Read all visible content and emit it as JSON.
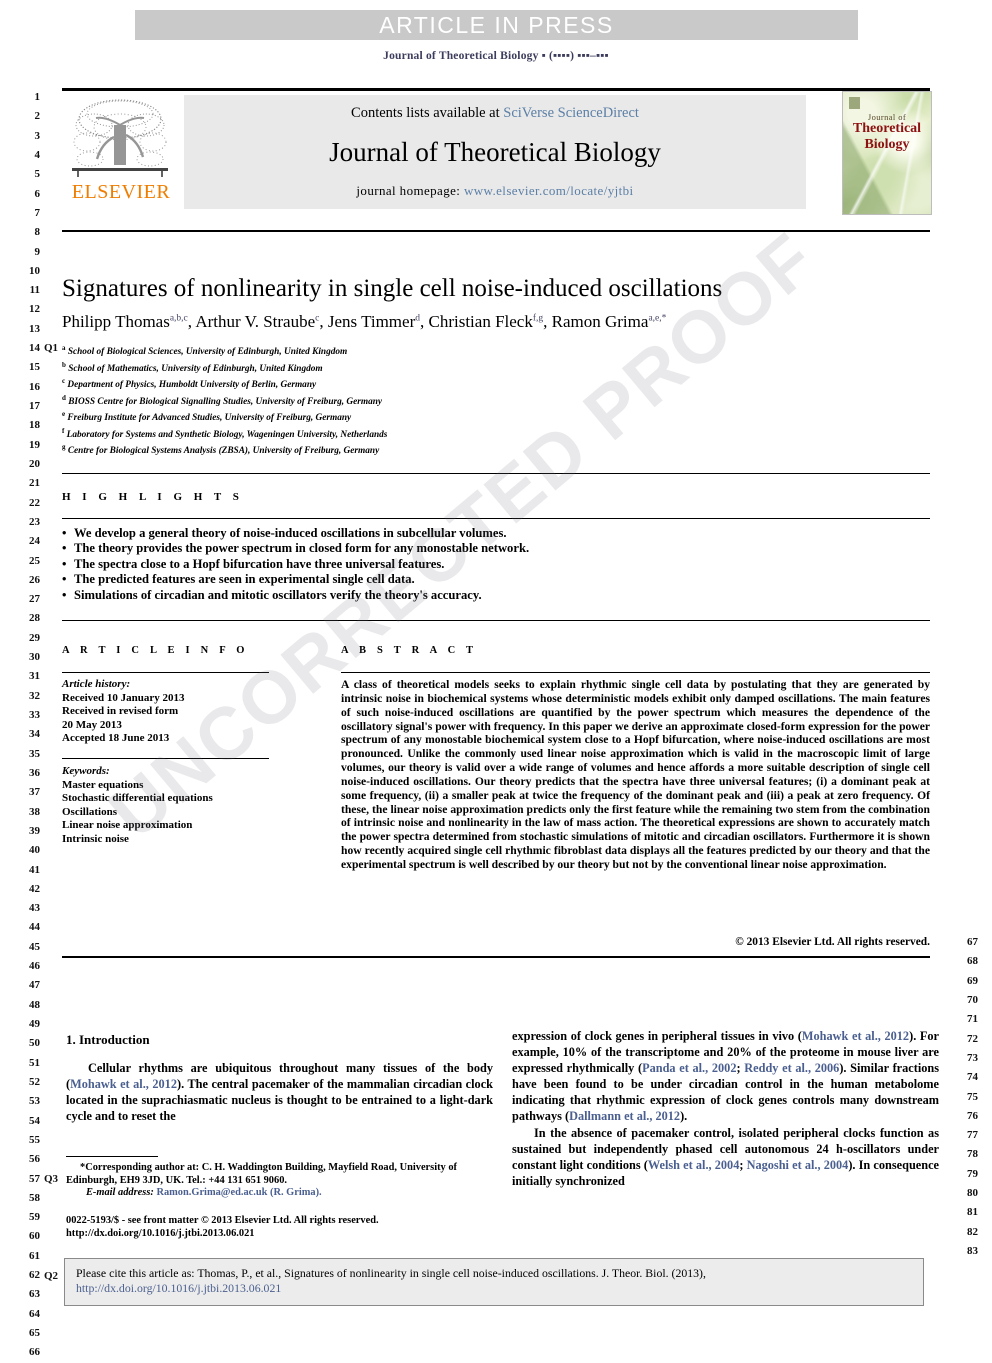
{
  "banner": {
    "text": "ARTICLE IN PRESS"
  },
  "running_head": "Journal of Theoretical Biology ▪ (▪▪▪▪) ▪▪▪–▪▪▪",
  "masthead": {
    "contents_prefix": "Contents lists available at ",
    "contents_link": "SciVerse ScienceDirect",
    "journal_title": "Journal of Theoretical Biology",
    "homepage_prefix": "journal homepage: ",
    "homepage_link": "www.elsevier.com/locate/yjtbi",
    "publisher": "ELSEVIER",
    "cover": {
      "line1": "Journal of",
      "line2": "Theoretical",
      "line3": "Biology"
    }
  },
  "article": {
    "title": "Signatures of nonlinearity in single cell noise-induced oscillations",
    "authors": [
      {
        "name": "Philipp Thomas",
        "sup": "a,b,c"
      },
      {
        "name": "Arthur V. Straube",
        "sup": "c"
      },
      {
        "name": "Jens Timmer",
        "sup": "d"
      },
      {
        "name": "Christian Fleck",
        "sup": "f,g"
      },
      {
        "name": "Ramon Grima",
        "sup": "a,e,*"
      }
    ],
    "affiliations": [
      {
        "key": "a",
        "text": "School of Biological Sciences, University of Edinburgh, United Kingdom"
      },
      {
        "key": "b",
        "text": "School of Mathematics, University of Edinburgh, United Kingdom"
      },
      {
        "key": "c",
        "text": "Department of Physics, Humboldt University of Berlin, Germany"
      },
      {
        "key": "d",
        "text": "BIOSS Centre for Biological Signalling Studies, University of Freiburg, Germany"
      },
      {
        "key": "e",
        "text": "Freiburg Institute for Advanced Studies, University of Freiburg, Germany"
      },
      {
        "key": "f",
        "text": "Laboratory for Systems and Synthetic Biology, Wageningen University, Netherlands"
      },
      {
        "key": "g",
        "text": "Centre for Biological Systems Analysis (ZBSA), University of Freiburg, Germany"
      }
    ]
  },
  "highlights": {
    "heading": "H I G H L I G H T S",
    "items": [
      "We develop a general theory of noise-induced oscillations in subcellular volumes.",
      "The theory provides the power spectrum in closed form for any monostable network.",
      "The spectra close to a Hopf bifurcation have three universal features.",
      "The predicted features are seen in experimental single cell data.",
      "Simulations of circadian and mitotic oscillators verify the theory's accuracy."
    ]
  },
  "article_info": {
    "heading": "A R T I C L E  I N F O",
    "history_label": "Article history:",
    "history": [
      "Received 10 January 2013",
      "Received in revised form",
      "20 May 2013",
      "Accepted 18 June 2013"
    ],
    "keywords_label": "Keywords:",
    "keywords": [
      "Master equations",
      "Stochastic differential equations",
      "Oscillations",
      "Linear noise approximation",
      "Intrinsic noise"
    ]
  },
  "abstract": {
    "heading": "A B S T R A C T",
    "text": "A class of theoretical models seeks to explain rhythmic single cell data by postulating that they are generated by intrinsic noise in biochemical systems whose deterministic models exhibit only damped oscillations. The main features of such noise-induced oscillations are quantified by the power spectrum which measures the dependence of the oscillatory signal's power with frequency. In this paper we derive an approximate closed-form expression for the power spectrum of any monostable biochemical system close to a Hopf bifurcation, where noise-induced oscillations are most pronounced. Unlike the commonly used linear noise approximation which is valid in the macroscopic limit of large volumes, our theory is valid over a wide range of volumes and hence affords a more suitable description of single cell noise-induced oscillations. Our theory predicts that the spectra have three universal features; (i) a dominant peak at some frequency, (ii) a smaller peak at twice the frequency of the dominant peak and (iii) a peak at zero frequency. Of these, the linear noise approximation predicts only the first feature while the remaining two stem from the combination of intrinsic noise and nonlinearity in the law of mass action. The theoretical expressions are shown to accurately match the power spectra determined from stochastic simulations of mitotic and circadian oscillators. Furthermore it is shown how recently acquired single cell rhythmic fibroblast data displays all the features predicted by our theory and that the experimental spectrum is well described by our theory but not by the conventional linear noise approximation.",
    "copyright": "© 2013 Elsevier Ltd. All rights reserved."
  },
  "body": {
    "section_number": "1.",
    "section_title": "Introduction",
    "left_column": [
      "Cellular rhythms are ubiquitous throughout many tissues of the body (Mohawk et al., 2012). The central pacemaker of the mammalian circadian clock located in the suprachiasmatic nucleus is thought to be entrained to a light-dark cycle and to reset the"
    ],
    "right_column": [
      "expression of clock genes in peripheral tissues in vivo (Mohawk et al., 2012). For example, 10% of the transcriptome and 20% of the proteome in mouse liver are expressed rhythmically (Panda et al., 2002; Reddy et al., 2006). Similar fractions have been found to be under circadian control in the human metabolome indicating that rhythmic expression of clock genes controls many downstream pathways (Dallmann et al., 2012).",
      "In the absence of pacemaker control, isolated peripheral clocks function as sustained but independently phased cell autonomous 24 h-oscillators under constant light conditions (Welsh et al., 2004; Nagoshi et al., 2004). In consequence initially synchronized"
    ]
  },
  "footnote": {
    "corresponding": "*Corresponding author at: C. H. Waddington Building, Mayfield Road, University of Edinburgh, EH9 3JD, UK. Tel.: +44 131 651 9060.",
    "email_label": "E-mail address:",
    "email": "Ramon.Grima@ed.ac.uk (R. Grima).",
    "issn_line": "0022-5193/$ - see front matter © 2013 Elsevier Ltd. All rights reserved.",
    "doi_line": "http://dx.doi.org/10.1016/j.jtbi.2013.06.021"
  },
  "citation_box": {
    "text": "Please cite this article as: Thomas, P., et al., Signatures of nonlinearity in single cell noise-induced oscillations. J. Theor. Biol. (2013), ",
    "link1": "http://dx.doi.org/10.1016/j.jtbi.2013.06.021"
  },
  "watermark": {
    "text": "UNCORRECTED PROOF"
  },
  "line_numbers": {
    "left_start": 1,
    "left_end": 66,
    "right_start": 67,
    "right_end": 83
  },
  "query_marks": [
    {
      "id": "Q1",
      "line": 14
    },
    {
      "id": "Q3",
      "line": 57
    },
    {
      "id": "Q2",
      "line": 62
    }
  ],
  "colors": {
    "link": "#4a5f8f",
    "elsevier_orange": "#ef7d00",
    "banner_bg": "#c9c9c9",
    "masthead_bg": "#e9e9e9",
    "cite_bg": "#ececec"
  }
}
